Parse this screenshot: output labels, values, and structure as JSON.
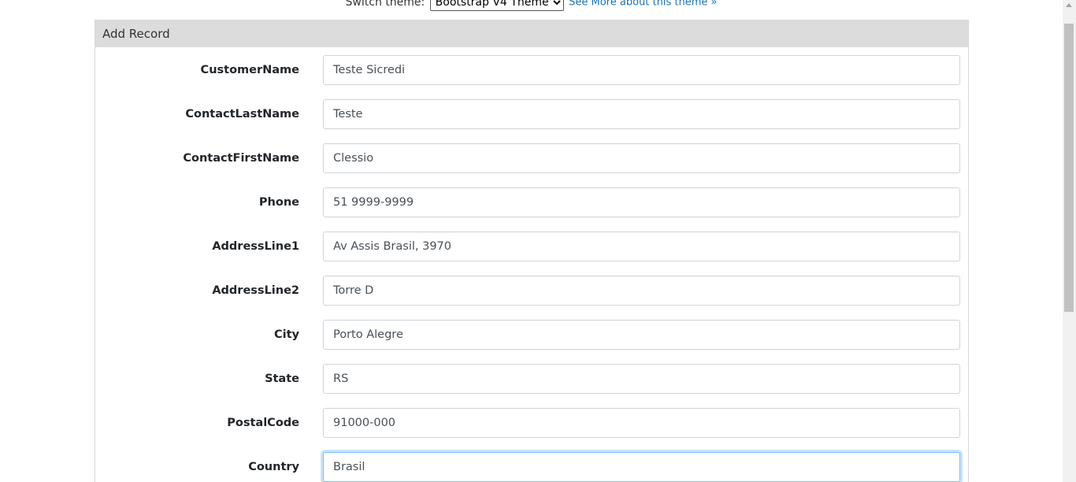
{
  "theme_switcher": {
    "label": "Switch theme:",
    "selected": "Bootstrap V4 Theme",
    "link": "See More about this theme »"
  },
  "panel": {
    "title": "Add Record"
  },
  "form": {
    "fields": [
      {
        "label": "CustomerName",
        "value": "Teste Sicredi"
      },
      {
        "label": "ContactLastName",
        "value": "Teste"
      },
      {
        "label": "ContactFirstName",
        "value": "Clessio"
      },
      {
        "label": "Phone",
        "value": "51 9999-9999"
      },
      {
        "label": "AddressLine1",
        "value": "Av Assis Brasil, 3970"
      },
      {
        "label": "AddressLine2",
        "value": "Torre D"
      },
      {
        "label": "City",
        "value": "Porto Alegre"
      },
      {
        "label": "State",
        "value": "RS"
      },
      {
        "label": "PostalCode",
        "value": "91000-000"
      },
      {
        "label": "Country",
        "value": "Brasil"
      }
    ]
  },
  "colors": {
    "header_bg": "#dcdcdc",
    "link": "#1a73b8",
    "focus_border": "#80bdff"
  }
}
